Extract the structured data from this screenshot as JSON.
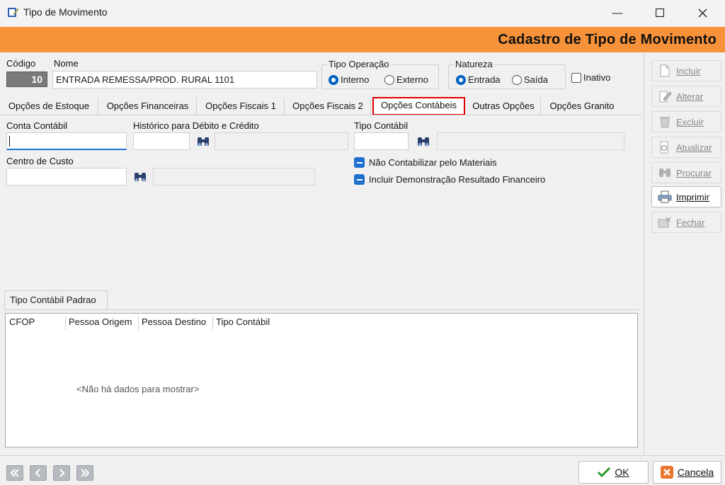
{
  "window": {
    "title": "Tipo de Movimento",
    "minimize": "—",
    "maximize": "☐",
    "close": "✕"
  },
  "header": {
    "title": "Cadastro de Tipo de Movimento"
  },
  "fields": {
    "codigo_label": "Código",
    "codigo_value": "10",
    "nome_label": "Nome",
    "nome_value": "ENTRADA REMESSA/PROD. RURAL 1101"
  },
  "tipo_operacao": {
    "title": "Tipo Operação",
    "options": [
      "Interno",
      "Externo"
    ],
    "selected": "Interno"
  },
  "natureza": {
    "title": "Natureza",
    "options": [
      "Entrada",
      "Saída"
    ],
    "selected": "Entrada"
  },
  "inativo_label": "Inativo",
  "tabs": [
    "Opções de Estoque",
    "Opções Financeiras",
    "Opções Fiscais 1",
    "Opções Fiscais 2",
    "Opções Contábeis",
    "Outras Opções",
    "Opções Granito"
  ],
  "active_tab": "Opções Contábeis",
  "contabil": {
    "conta_label": "Conta Contábil",
    "conta_value": "",
    "historico_label": "Histórico para Débito e Crédito",
    "tipo_label": "Tipo Contábil",
    "centro_label": "Centro de Custo",
    "nao_contabilizar": "Não Contabilizar pelo Materiais",
    "incluir_demonstracao": "Incluir Demonstração Resultado Financeiro"
  },
  "grid": {
    "tab_label": "Tipo Contábil Padrao",
    "columns": [
      "CFOP",
      "Pessoa Origem",
      "Pessoa Destino",
      "Tipo Contábil"
    ],
    "empty_text": "<Não há dados para mostrar>"
  },
  "toolbar": [
    {
      "label": "Incluir",
      "enabled": false
    },
    {
      "label": "Alterar",
      "enabled": false
    },
    {
      "label": "Excluir",
      "enabled": false
    },
    {
      "label": "Atualizar",
      "enabled": false
    },
    {
      "label": "Procurar",
      "enabled": false
    },
    {
      "label": "Imprimir",
      "enabled": true
    },
    {
      "label": "Fechar",
      "enabled": false
    }
  ],
  "footer": {
    "ok_label": "OK",
    "cancel_label": "Cancela"
  },
  "colors": {
    "header_orange": "#f7923a",
    "accent_blue": "#1f6fcf",
    "active_tab_border": "#e00000"
  }
}
